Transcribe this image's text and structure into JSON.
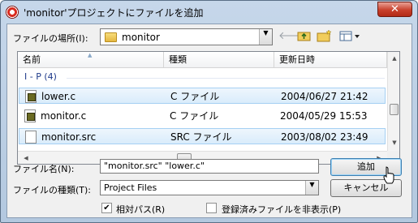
{
  "window": {
    "title": "'monitor'プロジェクトにファイルを追加",
    "close_label": "✕"
  },
  "location": {
    "label": "ファイルの場所(I):",
    "value": "monitor"
  },
  "toolbar": {
    "back_icon": "back-arrow-icon",
    "up_icon": "folder-up-icon",
    "new_folder_icon": "new-folder-icon",
    "view_icon": "view-menu-icon"
  },
  "file_list": {
    "columns": [
      "名前",
      "種類",
      "更新日時"
    ],
    "group_label": "I - P (4)",
    "rows": [
      {
        "name": "lower.c",
        "type": "C ファイル",
        "date": "2004/06/27 21:42",
        "state": "selected",
        "icon": "c-file-icon"
      },
      {
        "name": "monitor.c",
        "type": "C ファイル",
        "date": "2004/05/29 15:53",
        "state": "normal",
        "icon": "c-file-icon"
      },
      {
        "name": "monitor.src",
        "type": "SRC ファイル",
        "date": "2003/08/02 23:49",
        "state": "selected",
        "icon": "src-file-icon"
      }
    ]
  },
  "file_name": {
    "label": "ファイル名(N):",
    "value": "\"monitor.src\" \"lower.c\""
  },
  "file_type": {
    "label": "ファイルの種類(T):",
    "value": "Project Files"
  },
  "buttons": {
    "add": "追加",
    "cancel": "キャンセル"
  },
  "options": {
    "relative_path_label": "相対パス(R)",
    "relative_path_checked": true,
    "hide_registered_label": "登録済みファイルを非表示(P)",
    "hide_registered_checked": false
  },
  "colors": {
    "group_text": "#1e3a8a",
    "selection": "#d9ecfb",
    "close_button": "#c8402c"
  }
}
